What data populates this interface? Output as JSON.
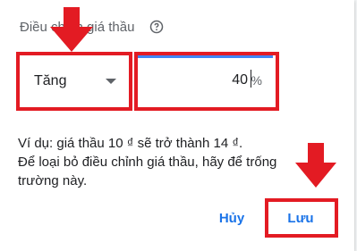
{
  "dialog": {
    "heading": "Điều chỉnh giá thầu",
    "help_icon": "help-circle-icon",
    "adjust_select": {
      "selected": "Tăng",
      "caret_icon": "dropdown-caret-icon"
    },
    "percent_input": {
      "value": "40",
      "unit": "%"
    },
    "help_lines": [
      "Ví dụ: giá thầu 10 ₫ sẽ trở thành 14 ₫.",
      "Để loại bỏ điều chỉnh giá thầu, hãy để trống",
      "trường này."
    ],
    "buttons": {
      "cancel": "Hủy",
      "save": "Lưu"
    }
  },
  "annotations": {
    "highlight_color": "#e31b23",
    "accent_color": "#4285f4",
    "button_color": "#1a73e8",
    "arrow_icon": "red-down-arrow-icon"
  }
}
